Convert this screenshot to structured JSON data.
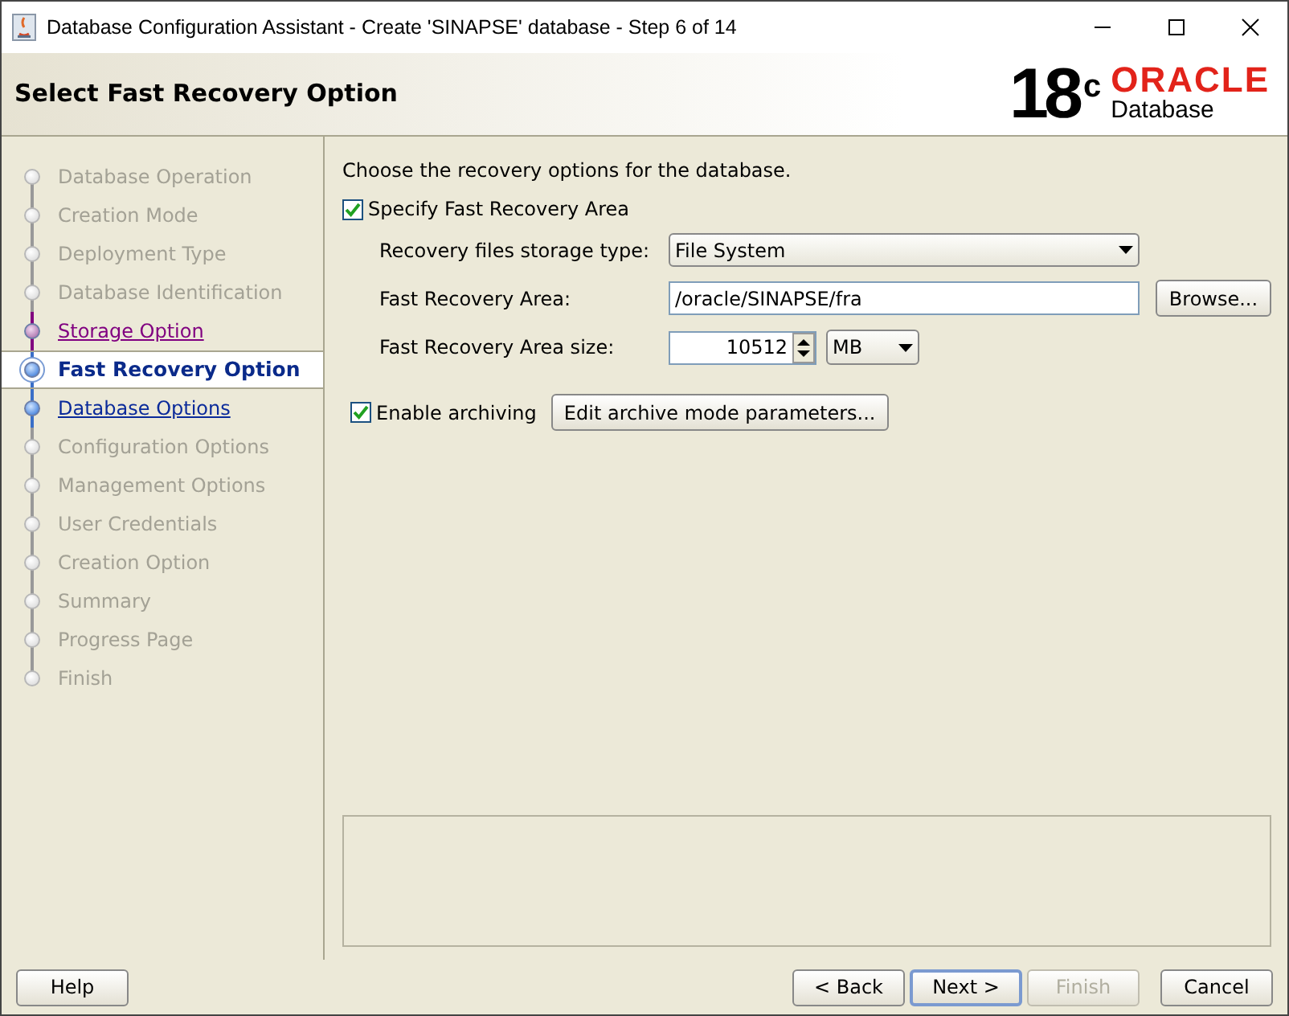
{
  "window": {
    "title": "Database Configuration Assistant - Create 'SINAPSE' database - Step 6 of 14"
  },
  "header": {
    "title": "Select Fast Recovery Option",
    "logo_version": "18",
    "logo_superscript": "c",
    "logo_brand": "ORACLE",
    "logo_product": "Database"
  },
  "steps": [
    {
      "label": "Database Operation",
      "selected": false,
      "visited": false,
      "disabled": true
    },
    {
      "label": "Creation Mode",
      "selected": false,
      "visited": false,
      "disabled": true
    },
    {
      "label": "Deployment Type",
      "selected": false,
      "visited": false,
      "disabled": true
    },
    {
      "label": "Database Identification",
      "selected": false,
      "visited": false,
      "disabled": true
    },
    {
      "label": "Storage Option",
      "selected": false,
      "visited": true,
      "disabled": false
    },
    {
      "label": "Fast Recovery Option",
      "selected": true,
      "visited": false,
      "disabled": false
    },
    {
      "label": "Database Options",
      "selected": false,
      "visited": false,
      "disabled": false
    },
    {
      "label": "Configuration Options",
      "selected": false,
      "visited": false,
      "disabled": true
    },
    {
      "label": "Management Options",
      "selected": false,
      "visited": false,
      "disabled": true
    },
    {
      "label": "User Credentials",
      "selected": false,
      "visited": false,
      "disabled": true
    },
    {
      "label": "Creation Option",
      "selected": false,
      "visited": false,
      "disabled": true
    },
    {
      "label": "Summary",
      "selected": false,
      "visited": false,
      "disabled": true
    },
    {
      "label": "Progress Page",
      "selected": false,
      "visited": false,
      "disabled": true
    },
    {
      "label": "Finish",
      "selected": false,
      "visited": false,
      "disabled": true
    }
  ],
  "intro": "Choose the recovery options for the database.",
  "specify_fra": {
    "label": "Specify Fast Recovery Area",
    "checked": true
  },
  "storage_type": {
    "label": "Recovery files storage type:",
    "value": "File System"
  },
  "fra_location": {
    "label": "Fast Recovery Area:",
    "value": "/oracle/SINAPSE/fra",
    "button": "Browse..."
  },
  "fra_size": {
    "label": "Fast Recovery Area size:",
    "value": "10512",
    "unit": "MB"
  },
  "archiving": {
    "label": "Enable archiving",
    "checked": true,
    "button": "Edit archive mode parameters..."
  },
  "help_button": {
    "label": "Help"
  },
  "buttons": [
    {
      "label": "< Back",
      "disabled": false,
      "default": false
    },
    {
      "label": "Next >",
      "disabled": false,
      "default": true
    },
    {
      "label": "Finish",
      "disabled": true,
      "default": false
    },
    {
      "label": "Cancel",
      "disabled": false,
      "default": false
    }
  ]
}
